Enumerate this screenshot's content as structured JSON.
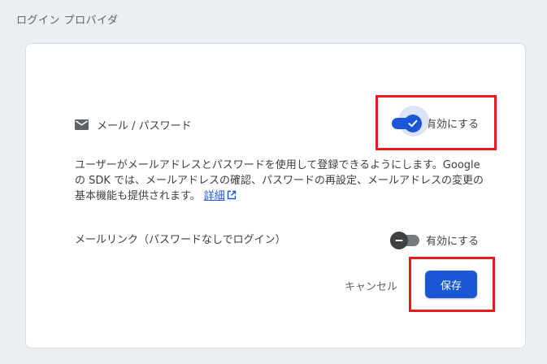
{
  "section": {
    "title": "ログイン プロバイダ"
  },
  "email_password": {
    "icon": "mail-icon",
    "label": "メール / パスワード",
    "toggle_label": "有効にする",
    "enabled": true,
    "description": "ユーザーがメールアドレスとパスワードを使用して登録できるようにします。Google の SDK では、メールアドレスの確認、パスワードの再設定、メールアドレスの変更の基本機能も提供されます。",
    "details_link": "詳細"
  },
  "email_link": {
    "label": "メールリンク（パスワードなしでログイン）",
    "toggle_label": "有効にする",
    "enabled": false
  },
  "actions": {
    "cancel_label": "キャンセル",
    "save_label": "保存"
  },
  "colors": {
    "accent": "#1a56d6",
    "highlight": "#e51c1c",
    "background": "#eceff1",
    "card": "#ffffff"
  }
}
